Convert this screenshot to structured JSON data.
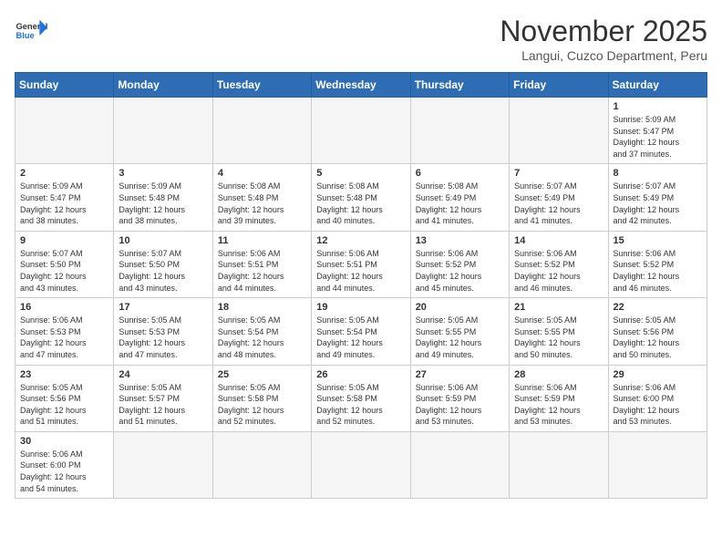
{
  "header": {
    "logo_general": "General",
    "logo_blue": "Blue",
    "month": "November 2025",
    "location": "Langui, Cuzco Department, Peru"
  },
  "weekdays": [
    "Sunday",
    "Monday",
    "Tuesday",
    "Wednesday",
    "Thursday",
    "Friday",
    "Saturday"
  ],
  "weeks": [
    [
      {
        "day": "",
        "info": ""
      },
      {
        "day": "",
        "info": ""
      },
      {
        "day": "",
        "info": ""
      },
      {
        "day": "",
        "info": ""
      },
      {
        "day": "",
        "info": ""
      },
      {
        "day": "",
        "info": ""
      },
      {
        "day": "1",
        "info": "Sunrise: 5:09 AM\nSunset: 5:47 PM\nDaylight: 12 hours\nand 37 minutes."
      }
    ],
    [
      {
        "day": "2",
        "info": "Sunrise: 5:09 AM\nSunset: 5:47 PM\nDaylight: 12 hours\nand 38 minutes."
      },
      {
        "day": "3",
        "info": "Sunrise: 5:09 AM\nSunset: 5:48 PM\nDaylight: 12 hours\nand 38 minutes."
      },
      {
        "day": "4",
        "info": "Sunrise: 5:08 AM\nSunset: 5:48 PM\nDaylight: 12 hours\nand 39 minutes."
      },
      {
        "day": "5",
        "info": "Sunrise: 5:08 AM\nSunset: 5:48 PM\nDaylight: 12 hours\nand 40 minutes."
      },
      {
        "day": "6",
        "info": "Sunrise: 5:08 AM\nSunset: 5:49 PM\nDaylight: 12 hours\nand 41 minutes."
      },
      {
        "day": "7",
        "info": "Sunrise: 5:07 AM\nSunset: 5:49 PM\nDaylight: 12 hours\nand 41 minutes."
      },
      {
        "day": "8",
        "info": "Sunrise: 5:07 AM\nSunset: 5:49 PM\nDaylight: 12 hours\nand 42 minutes."
      }
    ],
    [
      {
        "day": "9",
        "info": "Sunrise: 5:07 AM\nSunset: 5:50 PM\nDaylight: 12 hours\nand 43 minutes."
      },
      {
        "day": "10",
        "info": "Sunrise: 5:07 AM\nSunset: 5:50 PM\nDaylight: 12 hours\nand 43 minutes."
      },
      {
        "day": "11",
        "info": "Sunrise: 5:06 AM\nSunset: 5:51 PM\nDaylight: 12 hours\nand 44 minutes."
      },
      {
        "day": "12",
        "info": "Sunrise: 5:06 AM\nSunset: 5:51 PM\nDaylight: 12 hours\nand 44 minutes."
      },
      {
        "day": "13",
        "info": "Sunrise: 5:06 AM\nSunset: 5:52 PM\nDaylight: 12 hours\nand 45 minutes."
      },
      {
        "day": "14",
        "info": "Sunrise: 5:06 AM\nSunset: 5:52 PM\nDaylight: 12 hours\nand 46 minutes."
      },
      {
        "day": "15",
        "info": "Sunrise: 5:06 AM\nSunset: 5:52 PM\nDaylight: 12 hours\nand 46 minutes."
      }
    ],
    [
      {
        "day": "16",
        "info": "Sunrise: 5:06 AM\nSunset: 5:53 PM\nDaylight: 12 hours\nand 47 minutes."
      },
      {
        "day": "17",
        "info": "Sunrise: 5:05 AM\nSunset: 5:53 PM\nDaylight: 12 hours\nand 47 minutes."
      },
      {
        "day": "18",
        "info": "Sunrise: 5:05 AM\nSunset: 5:54 PM\nDaylight: 12 hours\nand 48 minutes."
      },
      {
        "day": "19",
        "info": "Sunrise: 5:05 AM\nSunset: 5:54 PM\nDaylight: 12 hours\nand 49 minutes."
      },
      {
        "day": "20",
        "info": "Sunrise: 5:05 AM\nSunset: 5:55 PM\nDaylight: 12 hours\nand 49 minutes."
      },
      {
        "day": "21",
        "info": "Sunrise: 5:05 AM\nSunset: 5:55 PM\nDaylight: 12 hours\nand 50 minutes."
      },
      {
        "day": "22",
        "info": "Sunrise: 5:05 AM\nSunset: 5:56 PM\nDaylight: 12 hours\nand 50 minutes."
      }
    ],
    [
      {
        "day": "23",
        "info": "Sunrise: 5:05 AM\nSunset: 5:56 PM\nDaylight: 12 hours\nand 51 minutes."
      },
      {
        "day": "24",
        "info": "Sunrise: 5:05 AM\nSunset: 5:57 PM\nDaylight: 12 hours\nand 51 minutes."
      },
      {
        "day": "25",
        "info": "Sunrise: 5:05 AM\nSunset: 5:58 PM\nDaylight: 12 hours\nand 52 minutes."
      },
      {
        "day": "26",
        "info": "Sunrise: 5:05 AM\nSunset: 5:58 PM\nDaylight: 12 hours\nand 52 minutes."
      },
      {
        "day": "27",
        "info": "Sunrise: 5:06 AM\nSunset: 5:59 PM\nDaylight: 12 hours\nand 53 minutes."
      },
      {
        "day": "28",
        "info": "Sunrise: 5:06 AM\nSunset: 5:59 PM\nDaylight: 12 hours\nand 53 minutes."
      },
      {
        "day": "29",
        "info": "Sunrise: 5:06 AM\nSunset: 6:00 PM\nDaylight: 12 hours\nand 53 minutes."
      }
    ],
    [
      {
        "day": "30",
        "info": "Sunrise: 5:06 AM\nSunset: 6:00 PM\nDaylight: 12 hours\nand 54 minutes."
      },
      {
        "day": "",
        "info": ""
      },
      {
        "day": "",
        "info": ""
      },
      {
        "day": "",
        "info": ""
      },
      {
        "day": "",
        "info": ""
      },
      {
        "day": "",
        "info": ""
      },
      {
        "day": "",
        "info": ""
      }
    ]
  ]
}
